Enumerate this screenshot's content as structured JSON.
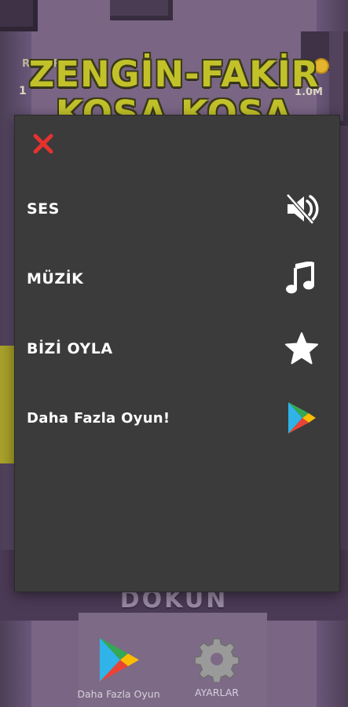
{
  "game": {
    "title_line1": "ZENGİN-FAKİR",
    "title_line2": "KOŞA KOŞA",
    "score_label": "REKOR",
    "score_value": "1",
    "coins_value": "1.0M",
    "tap_text": "DOKUN"
  },
  "settings_modal": {
    "close_icon": "close-x-icon",
    "items": [
      {
        "label": "SES",
        "icon": "speaker-muted-icon"
      },
      {
        "label": "MÜZİK",
        "icon": "music-note-icon"
      },
      {
        "label": "BİZİ OYLA",
        "icon": "star-icon"
      },
      {
        "label": "Daha Fazla Oyun!",
        "icon": "google-play-icon"
      }
    ]
  },
  "bottom_bar": {
    "more_games_label": "Daha Fazla Oyun",
    "settings_label": "AYARLAR"
  },
  "colors": {
    "background": "#6e5a78",
    "modal": "#3b3b3b",
    "close_red": "#e5322d",
    "title_yellow": "#c2c12a"
  }
}
